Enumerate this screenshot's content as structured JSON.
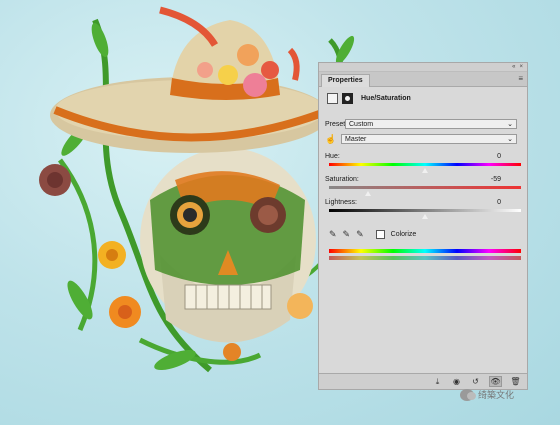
{
  "panel": {
    "tab": "Properties",
    "top_controls": [
      "«",
      "×"
    ],
    "tab_menu_icon": "menu-lines-icon",
    "adjustment_title": "Hue/Saturation",
    "preset_label": "Preset:",
    "preset_value": "Custom",
    "channel_value": "Master",
    "hue_label": "Hue:",
    "hue_value": "0",
    "saturation_label": "Saturation:",
    "saturation_value": "-59",
    "lightness_label": "Lightness:",
    "lightness_value": "0",
    "colorize_label": "Colorize",
    "colorize_checked": false,
    "hue_level": 0.5,
    "saturation_level": 0.205,
    "lightness_level": 0.5
  },
  "icons": {
    "eyedropper": "eyedropper-icon",
    "eyedropper_plus": "eyedropper-plus-icon",
    "eyedropper_minus": "eyedropper-minus-icon",
    "on_image": "hand-adjust-icon",
    "clip": "clip-to-layer-icon",
    "view_previous": "view-previous-icon",
    "reset": "reset-icon",
    "visibility": "eye-icon",
    "delete": "trash-icon"
  },
  "watermark": {
    "text": "绮築文化"
  }
}
